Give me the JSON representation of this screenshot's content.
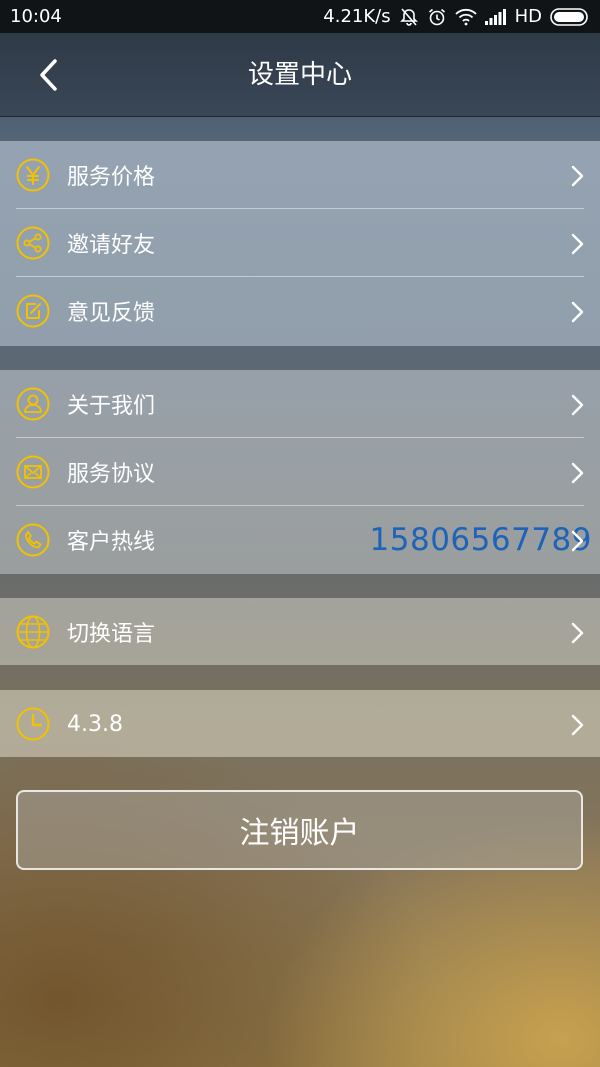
{
  "status_bar": {
    "time": "10:04",
    "speed": "4.21K/s",
    "network": "HD",
    "icons": [
      "mute-icon",
      "alarm-icon",
      "wifi-icon",
      "signal-icon",
      "battery-icon"
    ]
  },
  "header": {
    "title": "设置中心",
    "back_icon": "chevron-left-icon"
  },
  "groups": [
    {
      "items": [
        {
          "label": "服务价格",
          "icon": "yen-icon"
        },
        {
          "label": "邀请好友",
          "icon": "share-icon"
        },
        {
          "label": "意见反馈",
          "icon": "feedback-icon"
        }
      ]
    },
    {
      "items": [
        {
          "label": "关于我们",
          "icon": "person-icon"
        },
        {
          "label": "服务协议",
          "icon": "envelope-icon"
        },
        {
          "label": "客户热线",
          "icon": "phone-icon",
          "value": "15806567789"
        }
      ]
    },
    {
      "items": [
        {
          "label": "切换语言",
          "icon": "globe-icon"
        }
      ]
    },
    {
      "items": [
        {
          "label": "4.3.8",
          "icon": "clock-icon"
        }
      ]
    }
  ],
  "logout_button": {
    "label": "注销账户"
  },
  "colors": {
    "icon_accent": "#f2c200",
    "hotline_value": "#1e63b8",
    "status_bar_bg": "#111417"
  }
}
